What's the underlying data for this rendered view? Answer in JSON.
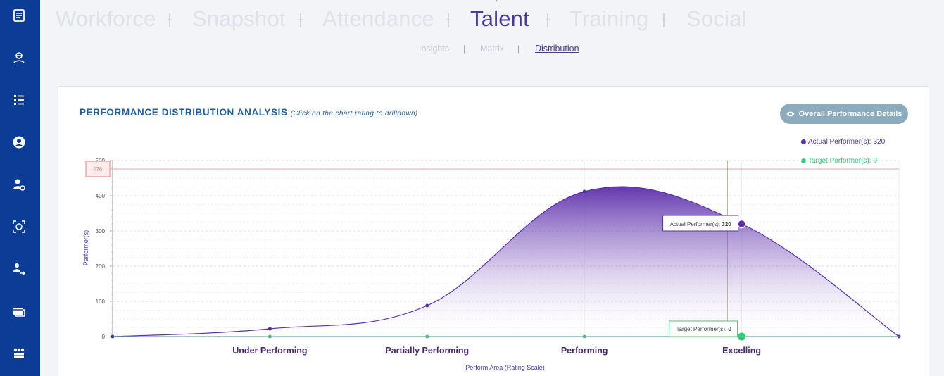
{
  "sidebar": {
    "icons": [
      "notepad-icon",
      "agent-icon",
      "checklist-icon",
      "user-circle-icon",
      "user-settings-icon",
      "face-scan-icon",
      "user-transfer-icon",
      "payment-card-icon",
      "team-grid-icon"
    ]
  },
  "nav": {
    "tabs": [
      {
        "label": "Workforce",
        "active": false
      },
      {
        "label": "Snapshot",
        "active": false
      },
      {
        "label": "Attendance",
        "active": false
      },
      {
        "label": "Talent",
        "active": true
      },
      {
        "label": "Training",
        "active": false
      },
      {
        "label": "Social",
        "active": false
      }
    ],
    "subtabs": [
      {
        "label": "Insights",
        "active": false
      },
      {
        "label": "Matrix",
        "active": false
      },
      {
        "label": "Distribution",
        "active": true
      }
    ]
  },
  "card": {
    "title": "PERFORMANCE DISTRIBUTION ANALYSIS",
    "hint": "(Click on the chart rating to drilldown)",
    "button_label": "Overall Performance Details"
  },
  "legend": [
    {
      "label": "Actual Performer(s):",
      "value": "320",
      "color": "#5b2da8"
    },
    {
      "label": "Target Performer(s):",
      "value": "0",
      "color": "#2ecc71"
    }
  ],
  "chart_data": {
    "type": "area",
    "categories": [
      "Under Performing",
      "Partially Performing",
      "Performing",
      "Excelling"
    ],
    "xlabel": "Perform Area (Rating Scale)",
    "ylabel": "Performer(s)",
    "ylim": [
      0,
      500
    ],
    "yticks": [
      0,
      100,
      200,
      300,
      400,
      500
    ],
    "series": [
      {
        "name": "Actual Performer(s)",
        "color": "#5b2da8",
        "x": [
          0,
          1,
          2,
          3,
          4,
          5
        ],
        "values": [
          0,
          22,
          88,
          412,
          320,
          0
        ]
      },
      {
        "name": "Target Performer(s)",
        "color": "#2ecc71",
        "x": [
          0,
          1,
          2,
          3,
          4,
          5
        ],
        "values": [
          0,
          0,
          0,
          0,
          0,
          0
        ]
      }
    ],
    "reference_line": {
      "value": 476,
      "label": "476",
      "color": "#f08080"
    },
    "highlight": {
      "x": 4,
      "category": "Excelling"
    },
    "tooltips": {
      "actual": {
        "label": "Actual Performer(s):",
        "value": "320"
      },
      "target": {
        "label": "Target Performer(s):",
        "value": "0"
      }
    },
    "grid": true
  }
}
